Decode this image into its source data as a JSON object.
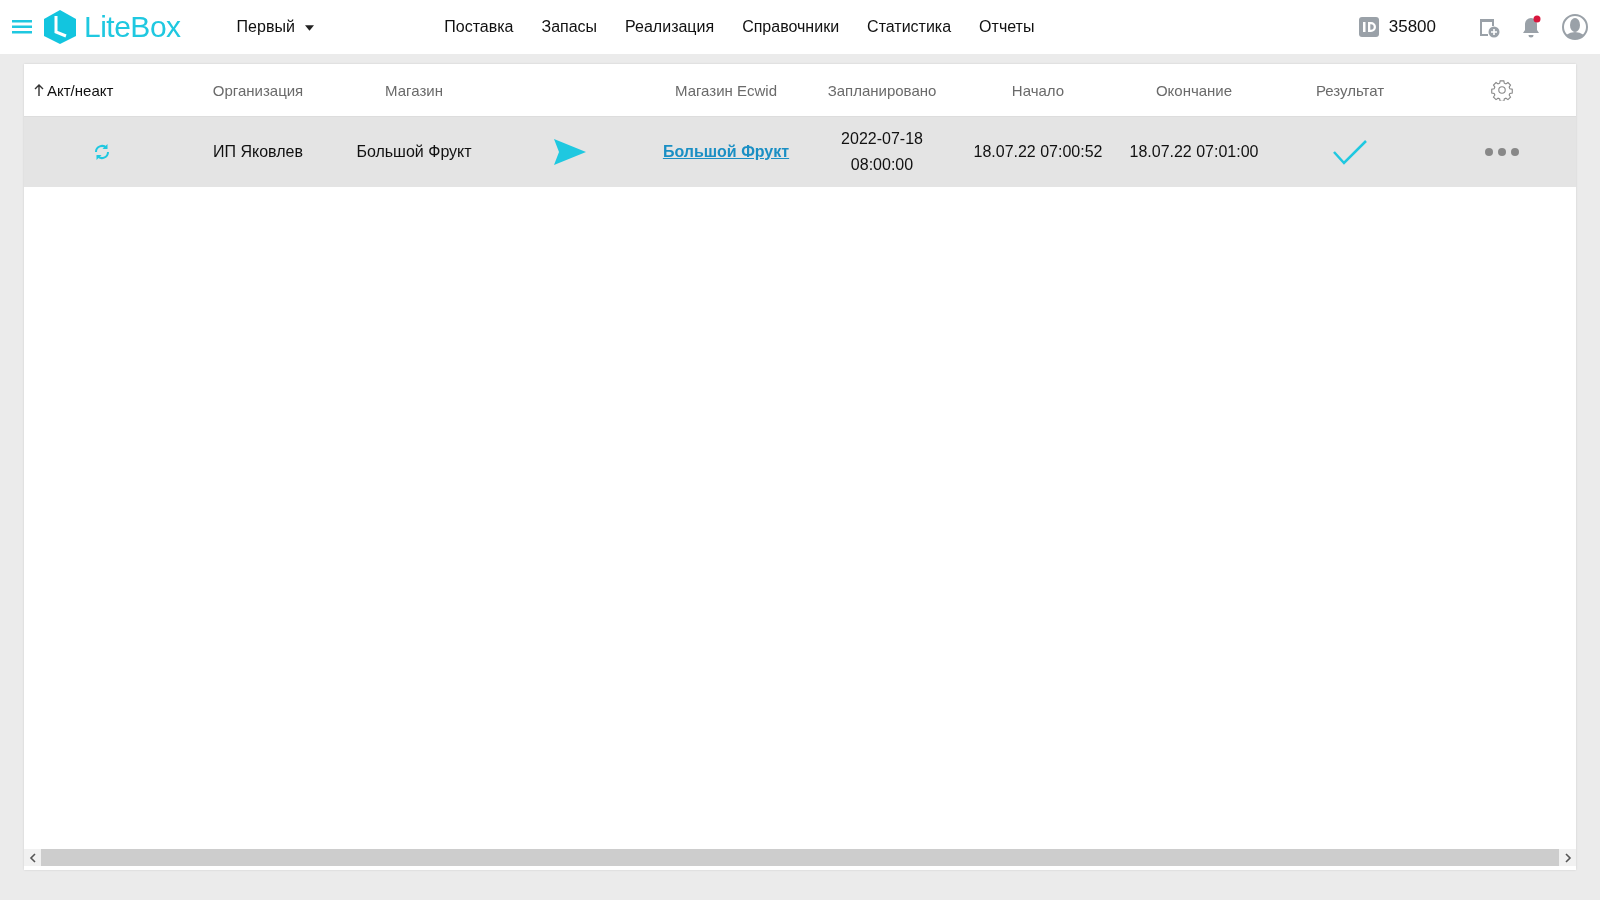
{
  "header": {
    "brand": "LiteBox",
    "org_selector": "Первый",
    "nav": [
      {
        "label": "Поставка"
      },
      {
        "label": "Запасы"
      },
      {
        "label": "Реализация"
      },
      {
        "label": "Справочники"
      },
      {
        "label": "Статистика"
      },
      {
        "label": "Отчеты"
      }
    ],
    "id_value": "35800",
    "notifications_unread": true
  },
  "table": {
    "columns": [
      {
        "label": "Акт/неакт",
        "sorted": true
      },
      {
        "label": "Организация",
        "sorted": false
      },
      {
        "label": "Магазин",
        "sorted": false
      },
      {
        "label": "Магазин Ecwid",
        "sorted": false
      },
      {
        "label": "Запланировано",
        "sorted": false
      },
      {
        "label": "Начало",
        "sorted": false
      },
      {
        "label": "Окончание",
        "sorted": false
      },
      {
        "label": "Результат",
        "sorted": false
      }
    ],
    "rows": [
      {
        "active": true,
        "organization": "ИП Яковлев",
        "store": "Большой Фрукт",
        "ecwid_store": "Большой Фрукт",
        "scheduled": [
          "2022-07-18",
          "08:00:00"
        ],
        "start": "18.07.22 07:00:52",
        "end": "18.07.22 07:01:00",
        "result_ok": true,
        "selected": true
      }
    ]
  }
}
